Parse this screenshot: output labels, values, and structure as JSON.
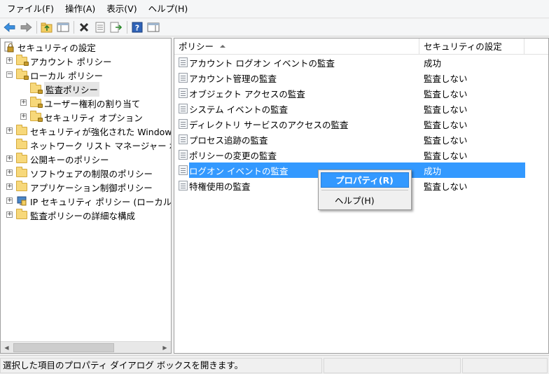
{
  "menubar": {
    "items": [
      "ファイル(F)",
      "操作(A)",
      "表示(V)",
      "ヘルプ(H)"
    ]
  },
  "toolbar": {
    "buttons": [
      "back-arrow-icon",
      "forward-arrow-icon",
      "up-folder-icon",
      "show-hide-tree-icon",
      "delete-icon",
      "properties-icon",
      "export-list-icon",
      "help-icon",
      "show-hide-action-pane-icon"
    ]
  },
  "tree": {
    "root": "セキュリティの設定",
    "items": [
      {
        "label": "アカウント ポリシー"
      },
      {
        "label": "ローカル ポリシー"
      },
      {
        "label": "監査ポリシー"
      },
      {
        "label": "ユーザー権利の割り当て"
      },
      {
        "label": "セキュリティ オプション"
      },
      {
        "label": "セキュリティが強化された Windows"
      },
      {
        "label": "ネットワーク リスト マネージャー ポ"
      },
      {
        "label": "公開キーのポリシー"
      },
      {
        "label": "ソフトウェアの制限のポリシー"
      },
      {
        "label": "アプリケーション制御ポリシー"
      },
      {
        "label": "IP セキュリティ ポリシー (ローカル"
      },
      {
        "label": "監査ポリシーの詳細な構成"
      }
    ]
  },
  "list": {
    "columns": {
      "policy": "ポリシー",
      "setting": "セキュリティの設定"
    },
    "rows": [
      {
        "name": "アカウント ログオン イベントの監査",
        "value": "成功"
      },
      {
        "name": "アカウント管理の監査",
        "value": "監査しない"
      },
      {
        "name": "オブジェクト アクセスの監査",
        "value": "監査しない"
      },
      {
        "name": "システム イベントの監査",
        "value": "監査しない"
      },
      {
        "name": "ディレクトリ サービスのアクセスの監査",
        "value": "監査しない"
      },
      {
        "name": "プロセス追跡の監査",
        "value": "監査しない"
      },
      {
        "name": "ポリシーの変更の監査",
        "value": "監査しない"
      },
      {
        "name": "ログオン イベントの監査",
        "value": "成功"
      },
      {
        "name": "特権使用の監査",
        "value": "監査しない"
      }
    ]
  },
  "context_menu": {
    "properties": "プロパティ(R)",
    "help": "ヘルプ(H)"
  },
  "statusbar": {
    "text": "選択した項目のプロパティ ダイアログ ボックスを開きます。"
  },
  "colors": {
    "selection": "#3399ff",
    "window_bg": "#f0f0f0"
  }
}
